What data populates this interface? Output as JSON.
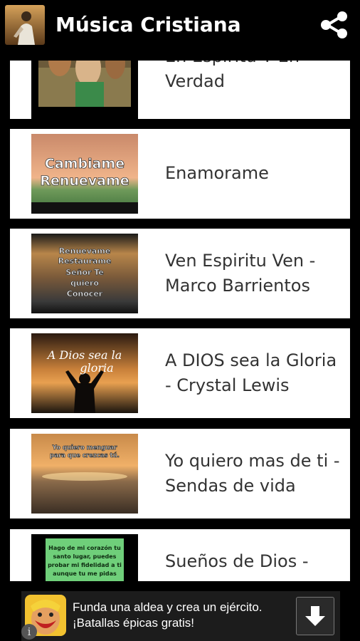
{
  "app_bar": {
    "title": "Música Cristiana",
    "app_icon": "praying-figure-icon",
    "share_icon": "share-icon"
  },
  "songs": [
    {
      "title": "En Espiritu Y En Verdad"
    },
    {
      "title": "Enamorame",
      "thumb_text": [
        "Cambiame",
        "Renuevame"
      ]
    },
    {
      "title": "Ven Espiritu Ven - Marco Barrientos",
      "thumb_text": [
        "Renuevame",
        "Restaurame",
        "Señor Te",
        "quiero",
        "Conocer"
      ]
    },
    {
      "title": "A DIOS sea la Gloria - Crystal Lewis",
      "thumb_text": [
        "A Dios sea la",
        "gloria"
      ]
    },
    {
      "title": "Yo quiero mas de ti  - Sendas de vida",
      "thumb_text": [
        "Yo quiero menguar",
        "para que crezcas tú."
      ]
    },
    {
      "title": "Sueños de Dios -",
      "thumb_text": [
        "Hago de mi  corazón tu",
        "santo lugar, puedes",
        "probar mi fidelidad a ti",
        "aunque tu me pidas"
      ]
    }
  ],
  "ad": {
    "text": "Funda una aldea y crea un ejército. ¡Batallas épicas gratis!",
    "icon": "clash-barbarian-icon",
    "download_icon": "download-arrow-icon",
    "info_icon": "info-icon"
  },
  "colors": {
    "background": "#000000",
    "card": "#ffffff",
    "title_text": "#333333"
  }
}
